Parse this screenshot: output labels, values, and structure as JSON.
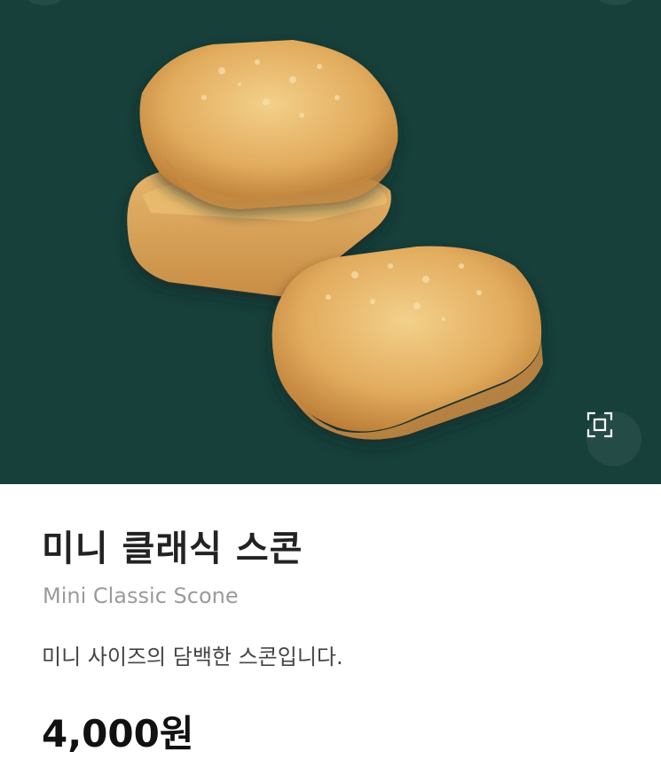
{
  "product": {
    "image_alt": "미니 클래식 스콘",
    "name_ko": "미니 클래식 스콘",
    "name_en": "Mini Classic Scone",
    "description": "미니 사이즈의 담백한 스콘입니다.",
    "price": "4,000원"
  },
  "icons": {
    "zoom": "expand-frame-icon"
  },
  "colors": {
    "hero_background": "#17403a",
    "title": "#222222",
    "subtitle": "#9b9b9b"
  }
}
